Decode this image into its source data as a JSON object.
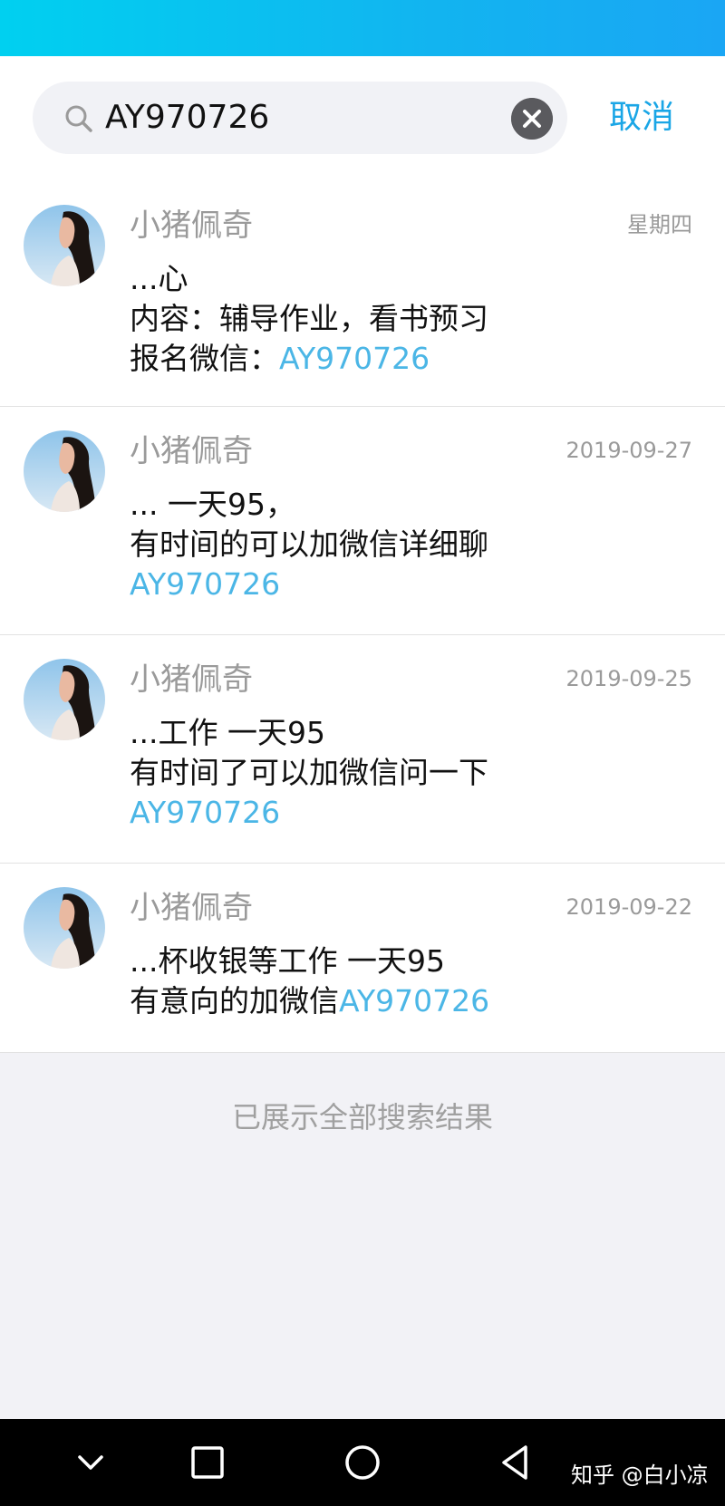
{
  "search": {
    "query": "AY970726",
    "cancel_label": "取消"
  },
  "results": [
    {
      "sender": "小猪佩奇",
      "date": "星期四",
      "line1": "...心",
      "line2": "内容：辅导作业，看书预习",
      "line3_prefix": "报名微信：",
      "line3_highlight": "AY970726"
    },
    {
      "sender": "小猪佩奇",
      "date": "2019-09-27",
      "line1": "...  一天95，",
      "line2": "有时间的可以加微信详细聊",
      "line3_highlight": "AY970726"
    },
    {
      "sender": "小猪佩奇",
      "date": "2019-09-25",
      "line1": "...工作 一天95",
      "line2": "有时间了可以加微信问一下",
      "line3_highlight": "AY970726"
    },
    {
      "sender": "小猪佩奇",
      "date": "2019-09-22",
      "line1": "...杯收银等工作  一天95",
      "line2_prefix": "有意向的加微信",
      "line2_highlight": "AY970726"
    }
  ],
  "footer_note": "已展示全部搜索结果",
  "watermark": "知乎 @白小凉",
  "colors": {
    "accent": "#1aa6e6",
    "highlight": "#4bb6e6",
    "status_bar_start": "#00d0f0",
    "status_bar_end": "#1aa6f4"
  },
  "icons": {
    "search": "search-icon",
    "clear": "close-circle-icon",
    "nav_back": "chevron-down-icon",
    "nav_recents": "square-icon",
    "nav_home": "circle-icon",
    "nav_triangle": "triangle-back-icon"
  }
}
